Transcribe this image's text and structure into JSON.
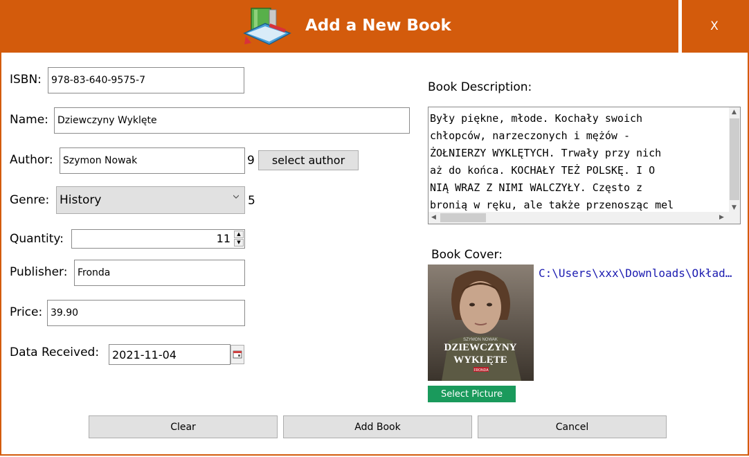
{
  "window": {
    "title": "Add a New Book",
    "close_label": "X",
    "accent_color": "#d35b0c"
  },
  "form": {
    "isbn_label": "ISBN:",
    "isbn_value": "978-83-640-9575-7",
    "name_label": "Name:",
    "name_value": "Dziewczyny Wyklęte",
    "author_label": "Author:",
    "author_value": "Szymon Nowak",
    "author_id": "9",
    "select_author_label": "select author",
    "genre_label": "Genre:",
    "genre_value": "History",
    "genre_id": "5",
    "quantity_label": "Quantity:",
    "quantity_value": "11",
    "publisher_label": "Publisher:",
    "publisher_value": "Fronda",
    "price_label": "Price:",
    "price_value": "39.90",
    "date_label": "Data Received:",
    "date_value": "2021-11-04"
  },
  "description": {
    "label": "Book Description:",
    "text": "Były piękne, młode. Kochały swoich\nchłopców, narzeczonych i mężów -\nŻOŁNIERZY WYKLĘTYCH. Trwały przy nich\naż do końca. KOCHAŁY TEŻ POLSKĘ. I O\nNIĄ WRAZ Z NIMI WALCZYŁY. Często z\nbronią w ręku, ale także przenosząc mel"
  },
  "cover": {
    "label": "Book Cover:",
    "path": "C:\\Users\\xxx\\Downloads\\Okładka.jpg",
    "select_button_label": "Select Picture",
    "image_author_text": "SZYMON NOWAK",
    "image_title_line1": "DZIEWCZYNY",
    "image_title_line2": "WYKLĘTE",
    "image_publisher_text": "FRONDA"
  },
  "actions": {
    "clear_label": "Clear",
    "add_label": "Add Book",
    "cancel_label": "Cancel"
  },
  "icons": [
    "books-logo-icon",
    "close-icon",
    "chevron-down-icon",
    "spin-up-icon",
    "spin-down-icon",
    "calendar-icon"
  ]
}
